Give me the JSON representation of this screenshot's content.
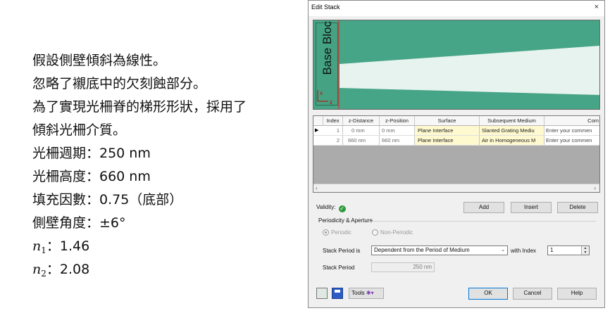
{
  "text_lines": [
    "假設側壁傾斜為線性。",
    "忽略了襯底中的欠刻蝕部分。",
    "為了實現光柵脊的梯形形狀，採用了",
    "傾斜光柵介質。",
    "光柵週期：250 nm",
    "光柵高度：660 nm",
    "填充因數：0.75（底部）",
    "側壁角度：±6°"
  ],
  "n1": {
    "symbol": "n",
    "sub": "1",
    "value": "：1.46"
  },
  "n2": {
    "symbol": "n",
    "sub": "2",
    "value": "：2.08"
  },
  "dialog": {
    "title": "Edit Stack",
    "close": "×",
    "preview": {
      "base_block_label": "Base Block",
      "axis_x": "x",
      "axis_z": "z",
      "colors": {
        "grating": "#46a586",
        "medium": "#e6f3ee",
        "boundary": "#d23c3c"
      }
    },
    "table": {
      "headers": [
        "Index",
        "z-Distance",
        "z-Position",
        "Surface",
        "Subsequent Medium",
        "Com"
      ],
      "rows": [
        {
          "pointer": "▶",
          "index": "1",
          "z_distance": "0 mm",
          "z_position": "0 mm",
          "surface": "Plane Interface",
          "medium": "Slanted Grating Mediu",
          "comment": "Enter your commen"
        },
        {
          "pointer": "",
          "index": "2",
          "z_distance": "660 nm",
          "z_position": "660 nm",
          "surface": "Plane Interface",
          "medium": "Air in Homogeneous M",
          "comment": "Enter your commen"
        }
      ],
      "scroll_left": "‹",
      "scroll_right": "›"
    },
    "validity_label": "Validity:",
    "validity_icon": "check-icon",
    "buttons": {
      "add": "Add",
      "insert": "Insert",
      "delete": "Delete"
    },
    "group_title": "Periodicity & Aperture",
    "radio_periodic": "Periodic",
    "radio_nonperiodic": "Non-Periodic",
    "stack_period_label": "Stack Period is",
    "stack_period_value": "Dependent from the Period of Medium",
    "with_index_label": "with Index",
    "with_index_value": "1",
    "stack_period_field_label": "Stack Period",
    "stack_period_field_value": "250 nm",
    "tools_label": "Tools",
    "ok": "OK",
    "cancel": "Cancel",
    "help": "Help"
  }
}
